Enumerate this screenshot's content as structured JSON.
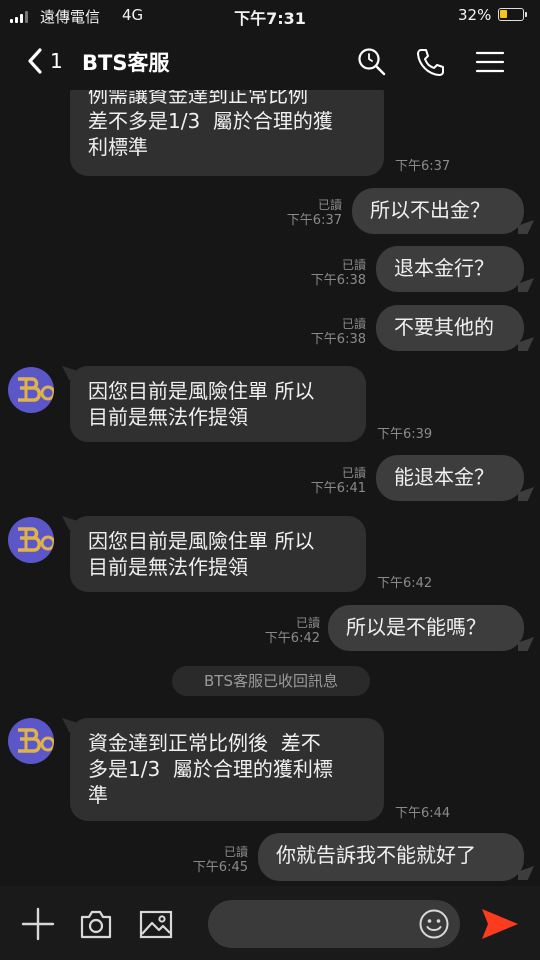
{
  "status_bar": {
    "carrier": "遠傳電信",
    "network": "4G",
    "time": "下午7:31",
    "battery_percent": "32%",
    "battery_level": 0.32,
    "icons": [
      "signal-icon",
      "battery-icon"
    ]
  },
  "header": {
    "back_count": "1",
    "title": "BTS客服",
    "icons": [
      "back-chevron-icon",
      "search-icon",
      "phone-icon",
      "menu-icon"
    ]
  },
  "messages": [
    {
      "id": "m0",
      "side": "in",
      "text": "例需讓資金達到正常比例\n差不多是1/3  屬於合理的獲\n利標準",
      "time": "下午6:37"
    },
    {
      "id": "m1",
      "side": "out",
      "text": "所以不出金？",
      "read": "已讀",
      "time": "下午6:37"
    },
    {
      "id": "m2",
      "side": "out",
      "text": "退本金行？",
      "read": "已讀",
      "time": "下午6:38"
    },
    {
      "id": "m3",
      "side": "out",
      "text": "不要其他的",
      "read": "已讀",
      "time": "下午6:38"
    },
    {
      "id": "m4",
      "side": "in",
      "text": "因您目前是風險住單 所以\n目前是無法作提領",
      "time": "下午6:39"
    },
    {
      "id": "m5",
      "side": "out",
      "text": "能退本金？",
      "read": "已讀",
      "time": "下午6:41"
    },
    {
      "id": "m6",
      "side": "in",
      "text": "因您目前是風險住單 所以\n目前是無法作提領",
      "time": "下午6:42"
    },
    {
      "id": "m7",
      "side": "out",
      "text": "所以是不能嗎？",
      "read": "已讀",
      "time": "下午6:42"
    },
    {
      "id": "m8",
      "side": "in",
      "text": "資金達到正常比例後  差不\n多是1/3  屬於合理的獲利標\n準",
      "time": "下午6:44"
    },
    {
      "id": "m9",
      "side": "out",
      "text": "你就告訴我不能就好了",
      "read": "已讀",
      "time": "下午6:45"
    }
  ],
  "system_message": "BTS客服已收回訊息",
  "input_bar": {
    "placeholder": "",
    "icons": [
      "plus-icon",
      "camera-icon",
      "image-icon",
      "emoji-icon",
      "send-icon"
    ],
    "send_color": "#ff3b1f"
  },
  "colors": {
    "background": "#161616",
    "incoming_bubble": "#303030",
    "outgoing_bubble": "#3d3d3d",
    "avatar_bg": "#5b57c9",
    "avatar_logo": "#e0b24a"
  }
}
